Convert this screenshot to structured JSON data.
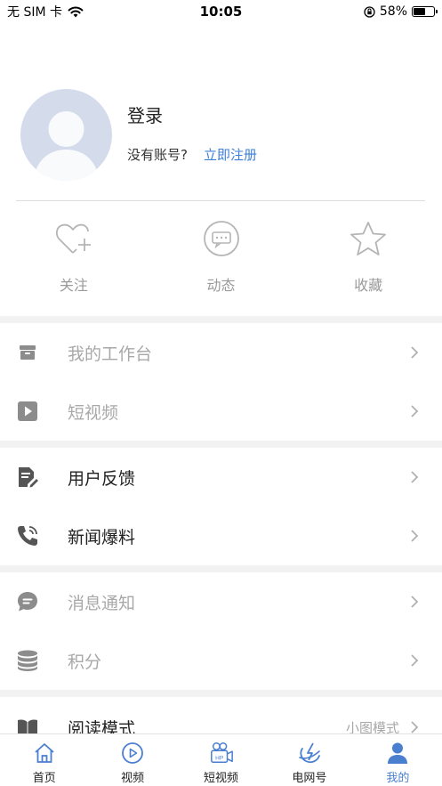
{
  "status_bar": {
    "carrier": "无 SIM 卡",
    "time": "10:05",
    "battery_pct": "58%",
    "battery_level": 0.58
  },
  "profile": {
    "login": "登录",
    "no_account": "没有账号?",
    "register": "立即注册"
  },
  "quick_actions": [
    {
      "label": "关注",
      "icon": "heart-plus-icon"
    },
    {
      "label": "动态",
      "icon": "chat-bubble-icon"
    },
    {
      "label": "收藏",
      "icon": "star-icon"
    }
  ],
  "menu": {
    "workbench": "我的工作台",
    "short_video": "短视频",
    "feedback": "用户反馈",
    "news_tip": "新闻爆料",
    "notifications": "消息通知",
    "points": "积分",
    "reading_mode": "阅读模式",
    "reading_mode_value": "小图模式"
  },
  "tabbar": [
    {
      "label": "首页",
      "icon": "home-icon"
    },
    {
      "label": "视频",
      "icon": "play-circle-icon"
    },
    {
      "label": "短视频",
      "icon": "camera-hp-icon"
    },
    {
      "label": "电网号",
      "icon": "grid-logo-icon"
    },
    {
      "label": "我的",
      "icon": "person-icon",
      "active": true
    }
  ],
  "colors": {
    "accent": "#4a7fd0",
    "link": "#3d7fd6",
    "avatar_bg": "#d4dcec",
    "separator": "#f2f2f2"
  }
}
